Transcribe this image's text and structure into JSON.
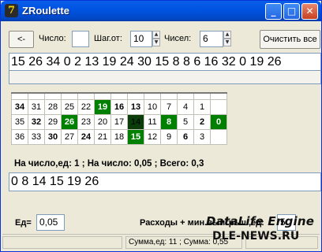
{
  "window": {
    "title": "ZRoulette",
    "icon_glyph": "7"
  },
  "titlebar_buttons": {
    "minimize": "_",
    "maximize": "□",
    "close": "✕"
  },
  "toolbar": {
    "back_label": "<-",
    "number_label": "Число:",
    "number_value": "",
    "step_from_label": "Шаг.от:",
    "step_from_value": "10",
    "numbers_label": "Чисел:",
    "numbers_value": "6",
    "clear_all_label": "Очистить все"
  },
  "history_text": "15 26 34 0 2 13 19 24 30 15 8 8 6 16 32 0 19 26",
  "grid": {
    "rows": [
      [
        "34",
        "31",
        "28",
        "25",
        "22",
        "19",
        "16",
        "13",
        "10",
        "7",
        "4",
        "1"
      ],
      [
        "35",
        "32",
        "29",
        "26",
        "23",
        "20",
        "17",
        "14",
        "11",
        "8",
        "5",
        "2"
      ],
      [
        "36",
        "33",
        "30",
        "27",
        "24",
        "21",
        "18",
        "15",
        "12",
        "9",
        "6",
        "3"
      ]
    ],
    "zero": "0"
  },
  "info_text": "На число,ед: 1 ; На число: 0,05 ; Всего: 0,3",
  "selected_text": "0 8 14 15 19 26",
  "bottom": {
    "unit_label": "Ед=",
    "unit_value": "0,05",
    "expenses_label": "Расходы + мин.выигрыш,ед:",
    "expenses_value": "5"
  },
  "statusbar": {
    "text": "Сумма,ед: 11 ; Сумма: 0,55"
  },
  "watermark": {
    "line1": "DataLife Engine",
    "line2": "DLE-NEWS.RU"
  }
}
